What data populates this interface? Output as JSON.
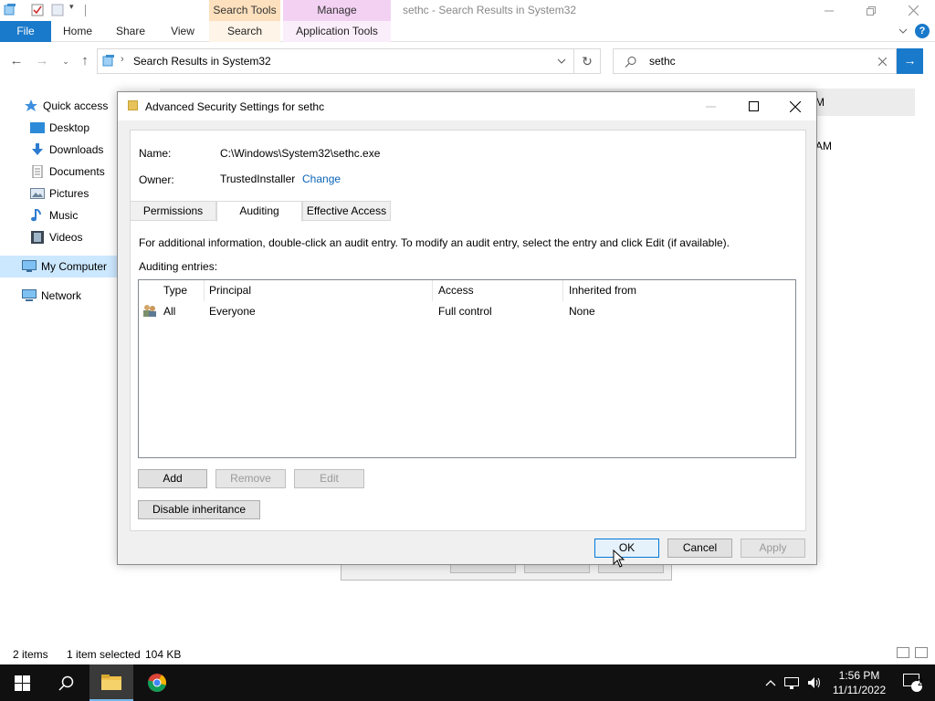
{
  "explorer": {
    "context_tabs": {
      "search_tools": "Search Tools",
      "manage": "Manage"
    },
    "window_title": "sethc - Search Results in System32",
    "ribbon_tabs": [
      "File",
      "Home",
      "Share",
      "View",
      "Search",
      "Application Tools"
    ],
    "address": "Search Results in System32",
    "search_value": "sethc",
    "nav": {
      "quick_access": "Quick access",
      "desktop": "Desktop",
      "downloads": "Downloads",
      "documents": "Documents",
      "pictures": "Pictures",
      "music": "Music",
      "videos": "Videos",
      "my_computer": "My Computer",
      "network": "Network"
    },
    "bg_fragments": {
      "row1": "M",
      "row2": "AM"
    },
    "status": {
      "items": "2 items",
      "selected": "1 item selected",
      "size": "104 KB"
    }
  },
  "dialog": {
    "title": "Advanced Security Settings for sethc",
    "name_label": "Name:",
    "name_value": "C:\\Windows\\System32\\sethc.exe",
    "owner_label": "Owner:",
    "owner_value": "TrustedInstaller",
    "owner_change": "Change",
    "tabs": [
      "Permissions",
      "Auditing",
      "Effective Access"
    ],
    "active_tab": "Auditing",
    "info_text": "For additional information, double-click an audit entry. To modify an audit entry, select the entry and click Edit (if available).",
    "entries_label": "Auditing entries:",
    "columns": [
      "Type",
      "Principal",
      "Access",
      "Inherited from"
    ],
    "rows": [
      {
        "type": "All",
        "principal": "Everyone",
        "access": "Full control",
        "inherited": "None"
      }
    ],
    "buttons": {
      "add": "Add",
      "remove": "Remove",
      "edit": "Edit",
      "disable_inheritance": "Disable inheritance",
      "ok": "OK",
      "cancel": "Cancel",
      "apply": "Apply"
    }
  },
  "taskbar": {
    "time": "1:56 PM",
    "date": "11/11/2022",
    "notification_count": "2"
  },
  "colors": {
    "accent": "#1979ca",
    "taskbar": "#101010",
    "selected_nav": "#cce8ff",
    "link": "#0b63b5"
  }
}
